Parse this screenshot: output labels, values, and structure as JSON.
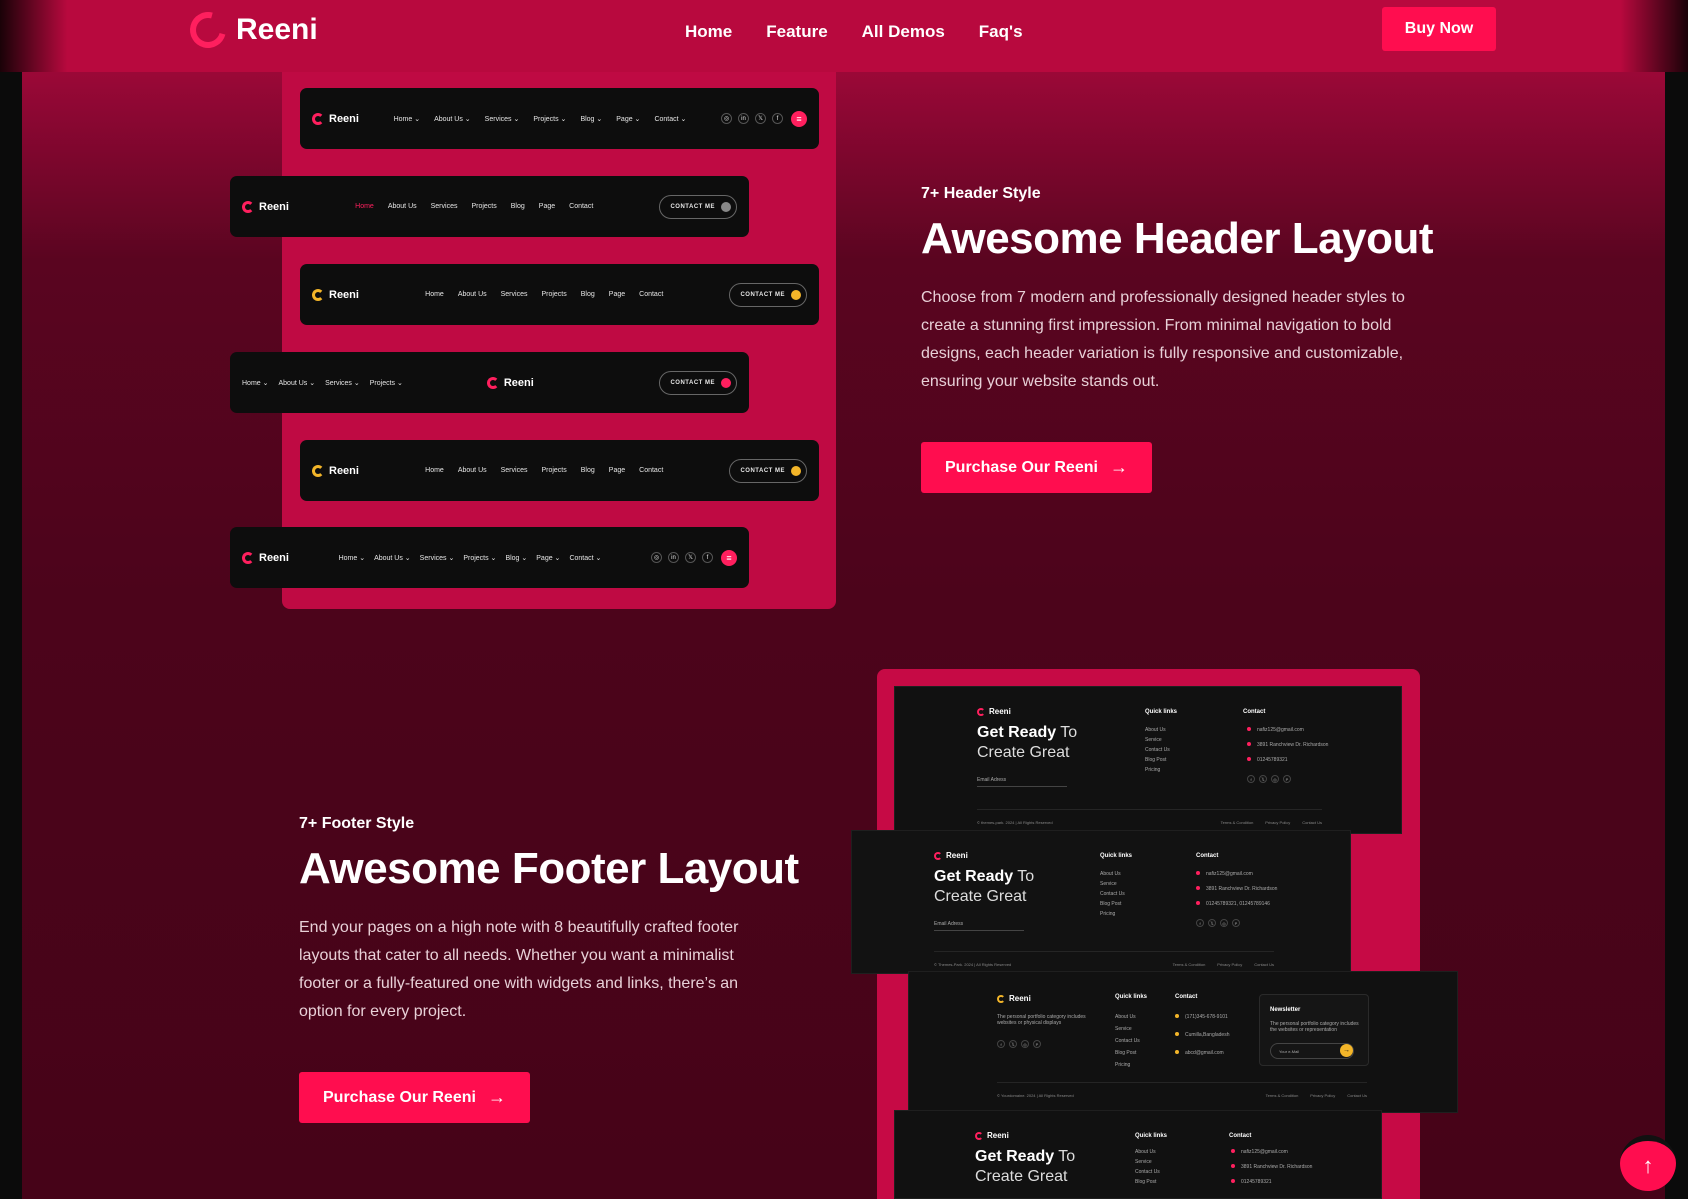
{
  "topbar": {
    "brand": "Reeni",
    "nav": [
      "Home",
      "Feature",
      "All Demos",
      "Faq's"
    ],
    "buy_label": "Buy Now"
  },
  "header_section": {
    "eyebrow": "7+ Header Style",
    "title": "Awesome Header Layout",
    "paragraph": "Choose from 7 modern and professionally designed header styles to create a stunning first impression. From minimal navigation to bold designs, each header variation is fully responsive and customizable, ensuring your website stands out.",
    "cta": "Purchase Our Reeni",
    "previews": {
      "logo": "Reeni",
      "nav_dropdown": [
        "Home ⌄",
        "About Us ⌄",
        "Services ⌄",
        "Projects ⌄",
        "Blog ⌄",
        "Page ⌄",
        "Contact ⌄"
      ],
      "nav_plain": [
        "Home",
        "About Us",
        "Services",
        "Projects",
        "Blog",
        "Page",
        "Contact"
      ],
      "nav_left_split": [
        "Home ⌄",
        "About Us ⌄",
        "Services ⌄",
        "Projects ⌄"
      ],
      "contact_me": "CONTACT ME",
      "social": [
        "◎",
        "in",
        "𝕏",
        "f"
      ]
    }
  },
  "footer_section": {
    "eyebrow": "7+ Footer Style",
    "title": "Awesome Footer Layout",
    "paragraph": "End your pages on a high note with 8 beautifully crafted footer layouts that cater to all needs. Whether you want a minimalist footer or a fully-featured one with widgets and links, there’s an option for every project.",
    "cta": "Purchase Our Reeni",
    "previews": {
      "logo": "Reeni",
      "headline_bold": "Get Ready",
      "headline_light": "To",
      "headline_line2": "Create Great",
      "email_label": "Email Adress",
      "quick_links_title": "Quick links",
      "quick_links": [
        "About Us",
        "Service",
        "Contact Us",
        "Blog Post",
        "Pricing"
      ],
      "contact_title": "Contact",
      "contacts_a": [
        "nafiz125@gmail.com",
        "3891 Ranchview Dr. Richardson",
        "01245789321"
      ],
      "contacts_b": [
        "nafiz125@gmail.com",
        "3891 Ranchview Dr. Richardson",
        "01245789321, 01245789146"
      ],
      "contacts_c": [
        "(171)345-678-9101",
        "Cumilla,Bangladesh",
        "abcd@gmail.com"
      ],
      "copyright_a": "© themes-park. 2024 | All Rights Reserved",
      "copyright_b": "© Themes-Park. 2024 | All Rights Reserved",
      "copyright_c": "© Yourdomaine. 2024 | All Rights Reserved",
      "legal": [
        "Terms & Condition",
        "Privacy Policy",
        "Contact Us"
      ],
      "about_text": "The personal portfolio category includes websites or physical displays",
      "newsletter_title": "Newsletter",
      "newsletter_text": "The personal portfolio category includes the websites or representation",
      "newsletter_placeholder": "Your e-Mail",
      "social": [
        "f",
        "𝕏",
        "◎",
        "P"
      ]
    }
  },
  "scroll_top": "↑",
  "colors": {
    "accent": "#ff0d4f",
    "bg": "#4c041b",
    "yellow": "#f3b529"
  }
}
